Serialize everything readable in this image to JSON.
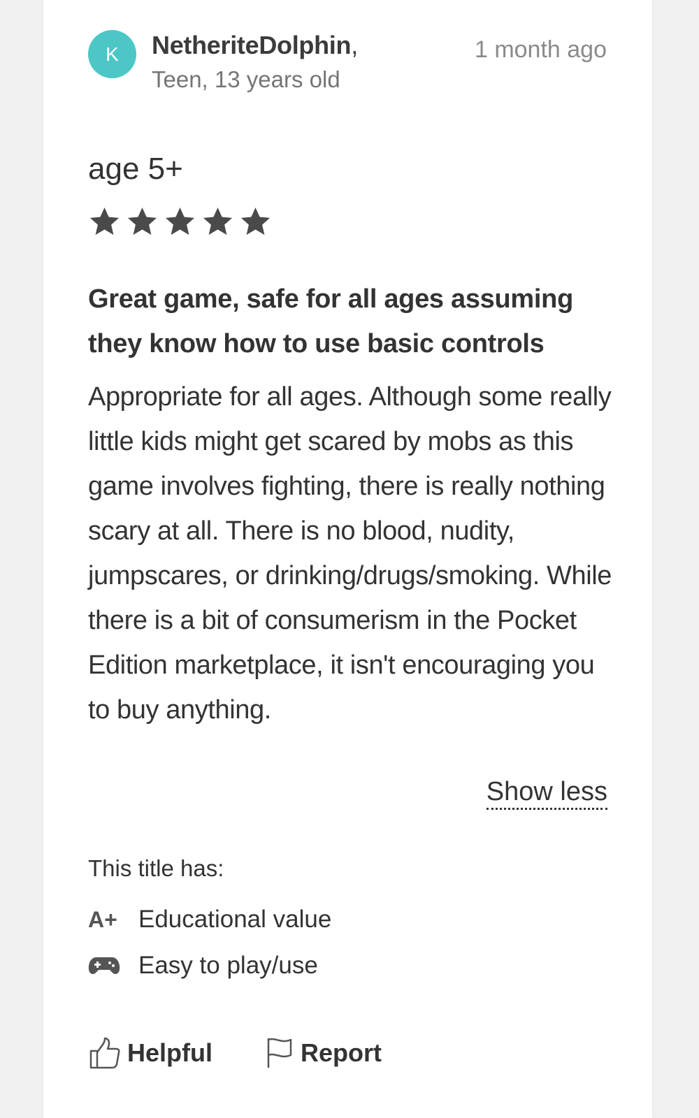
{
  "review": {
    "avatar_letter": "K",
    "avatar_color": "#4cc7c6",
    "username": "NetheriteDolphin",
    "username_suffix": ",",
    "user_info": "Teen, 13 years old",
    "timestamp": "1 month ago",
    "age_rating": "age 5+",
    "stars": {
      "rating": 5,
      "max": 5,
      "icon": "star-icon"
    },
    "title": "Great game, safe for all ages assuming they know how to use basic controls",
    "body": "Appropriate for all ages. Although some really little kids might get scared by mobs as this game involves fighting, there is really nothing scary at all. There is no blood, nudity, jumpscares, or drinking/drugs/smoking. While there is a bit of consumerism in the Pocket Edition marketplace, it isn't encouraging you to buy anything.",
    "show_less_label": "Show less",
    "title_has_label": "This title has:",
    "attributes": [
      {
        "icon": "a-plus-icon",
        "icon_text": "A+",
        "label": "Educational value"
      },
      {
        "icon": "gamepad-icon",
        "label": "Easy to play/use"
      }
    ],
    "actions": {
      "helpful_label": "Helpful",
      "helpful_icon": "thumbs-up-icon",
      "report_label": "Report",
      "report_icon": "flag-icon"
    }
  }
}
